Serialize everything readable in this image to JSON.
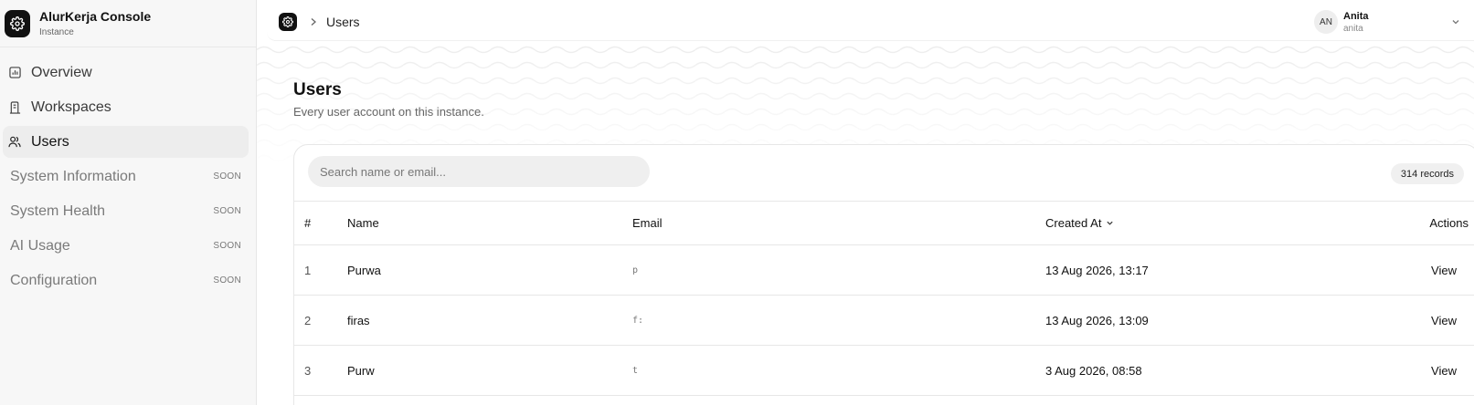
{
  "brand": {
    "name": "AlurKerja Console",
    "subtitle": "Instance"
  },
  "sidebar": {
    "items": [
      {
        "label": "Overview"
      },
      {
        "label": "Workspaces"
      },
      {
        "label": "Users"
      },
      {
        "label": "System Information",
        "badge": "SOON"
      },
      {
        "label": "System Health",
        "badge": "SOON"
      },
      {
        "label": "AI Usage",
        "badge": "SOON"
      },
      {
        "label": "Configuration",
        "badge": "SOON"
      }
    ]
  },
  "breadcrumb": {
    "current": "Users"
  },
  "user": {
    "initials": "AN",
    "name": "Anita",
    "email": "anita"
  },
  "page": {
    "title": "Users",
    "subtitle": "Every user account on this instance."
  },
  "search": {
    "placeholder": "Search name or email...",
    "value": ""
  },
  "records_count": "314 records",
  "table": {
    "columns": {
      "num": "#",
      "name": "Name",
      "email": "Email",
      "created": "Created At",
      "actions": "Actions"
    },
    "rows": [
      {
        "num": "1",
        "name": "Purwa",
        "email": "p",
        "created": "13 Aug 2026, 13:17",
        "action": "View"
      },
      {
        "num": "2",
        "name": "firas",
        "email": "f:",
        "created": "13 Aug 2026, 13:09",
        "action": "View"
      },
      {
        "num": "3",
        "name": "Purw",
        "email": "t",
        "created": "3 Aug 2026, 08:58",
        "action": "View"
      }
    ]
  },
  "colors": {
    "accent": "#111111",
    "sidebar_bg": "#f7f7f7",
    "active_bg": "#ededed"
  }
}
